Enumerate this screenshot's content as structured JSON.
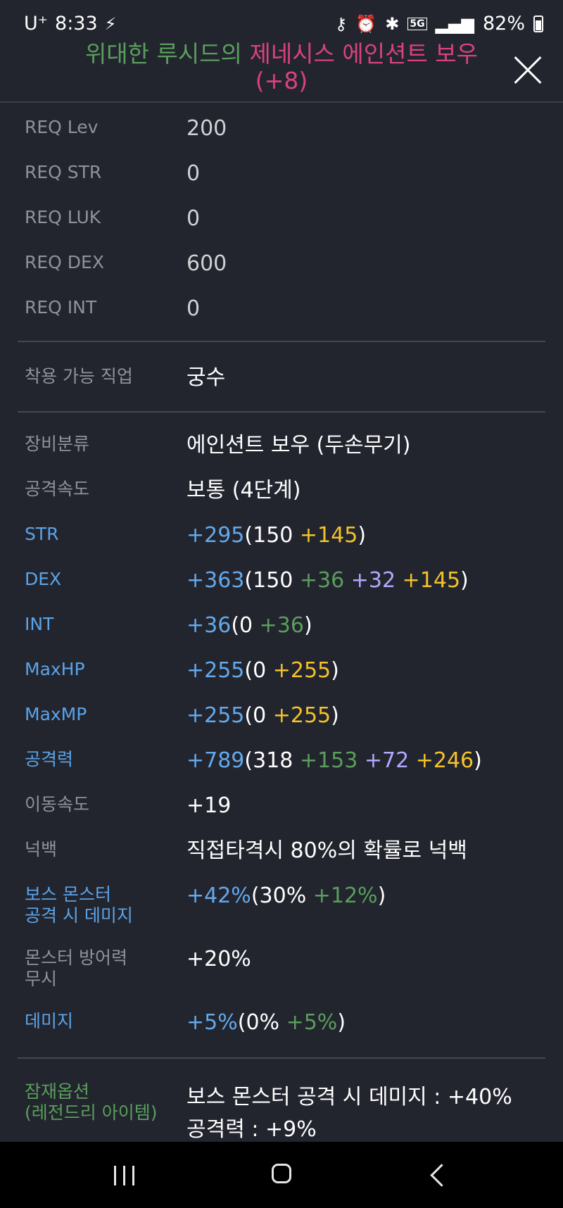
{
  "status": {
    "carrier": "U⁺",
    "time": "8:33",
    "network": "5G",
    "battery": "82%"
  },
  "header": {
    "title_prefix": "위대한 루시드의",
    "title_item": "제네시스 에인션트 보우",
    "title_enhance": "(+8)"
  },
  "requirements": [
    {
      "label": "REQ Lev",
      "value": "200"
    },
    {
      "label": "REQ STR",
      "value": "0"
    },
    {
      "label": "REQ LUK",
      "value": "0"
    },
    {
      "label": "REQ DEX",
      "value": "600"
    },
    {
      "label": "REQ INT",
      "value": "0"
    }
  ],
  "job": {
    "label": "착용 가능 직업",
    "value": "궁수"
  },
  "stats": {
    "category": {
      "label": "장비분류",
      "value": "에인션트 보우 (두손무기)"
    },
    "attack_speed": {
      "label": "공격속도",
      "value": "보통 (4단계)"
    },
    "str": {
      "label": "STR",
      "total": "+295",
      "base": "(150 ",
      "p1": "+145",
      "end": ")"
    },
    "dex": {
      "label": "DEX",
      "total": "+363",
      "base": "(150 ",
      "p1": "+36",
      "p2": "+32",
      "p3": "+145",
      "end": ")"
    },
    "int": {
      "label": "INT",
      "total": "+36",
      "base": "(0 ",
      "p1": "+36",
      "end": ")"
    },
    "maxhp": {
      "label": "MaxHP",
      "total": "+255",
      "base": "(0 ",
      "p1": "+255",
      "end": ")"
    },
    "maxmp": {
      "label": "MaxMP",
      "total": "+255",
      "base": "(0 ",
      "p1": "+255",
      "end": ")"
    },
    "attack": {
      "label": "공격력",
      "total": "+789",
      "base": "(318 ",
      "p1": "+153",
      "p2": "+72",
      "p3": "+246",
      "end": ")"
    },
    "move_speed": {
      "label": "이동속도",
      "value": "+19"
    },
    "knockback": {
      "label": "넉백",
      "value": "직접타격시 80%의 확률로 넉백"
    },
    "boss_damage": {
      "label1": "보스 몬스터",
      "label2": "공격 시 데미지",
      "total": "+42%",
      "base": "(30% ",
      "p1": "+12%",
      "end": ")"
    },
    "ignore_def": {
      "label1": "몬스터 방어력",
      "label2": "무시",
      "value": "+20%"
    },
    "damage": {
      "label": "데미지",
      "total": "+5%",
      "base": "(0% ",
      "p1": "+5%",
      "end": ")"
    }
  },
  "potential": {
    "label1": "잠재옵션",
    "label2": "(레전드리 아이템)",
    "line1": "보스 몬스터 공격 시 데미지 : +40%",
    "line2": "공격력 : +9%"
  },
  "icons": [
    "vpn-key-icon",
    "alarm-icon",
    "bluetooth-icon",
    "signal-icon",
    "battery-icon",
    "close-icon"
  ]
}
